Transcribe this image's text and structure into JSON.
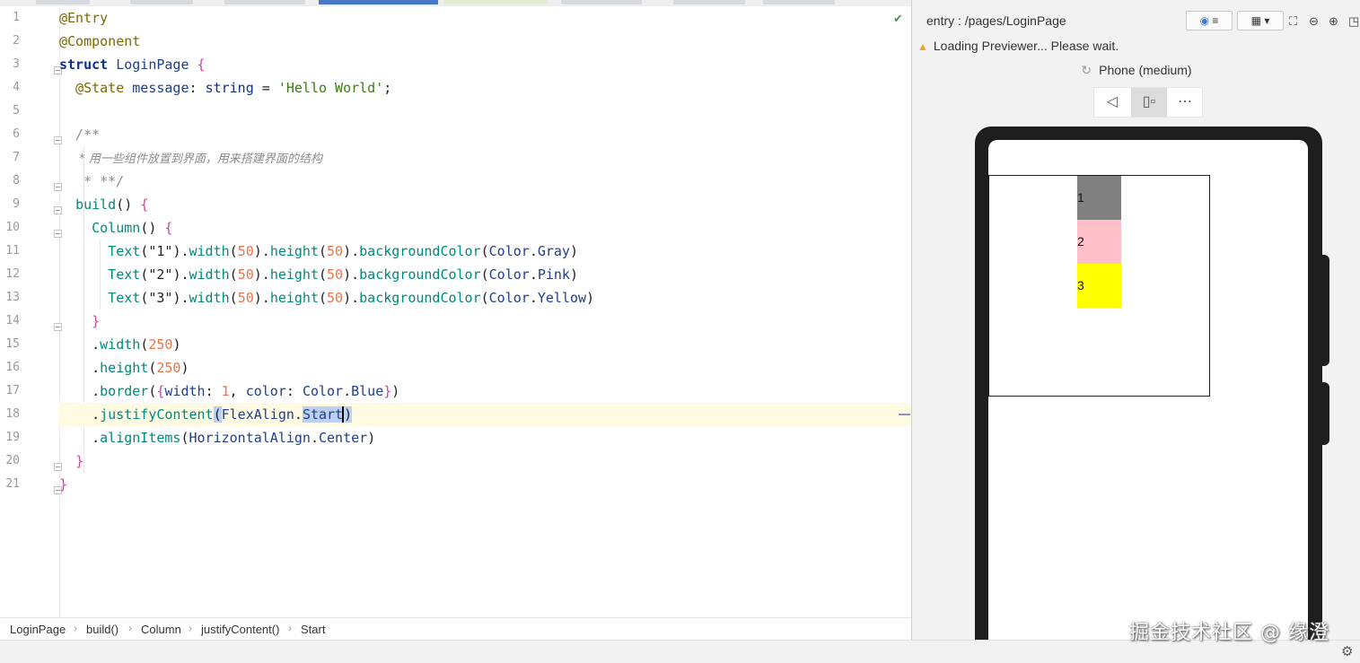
{
  "editor": {
    "line_numbers": [
      "1",
      "2",
      "3",
      "4",
      "5",
      "6",
      "7",
      "8",
      "9",
      "10",
      "11",
      "12",
      "13",
      "14",
      "15",
      "16",
      "17",
      "18",
      "19",
      "20",
      "21"
    ],
    "code": {
      "l1": "@Entry",
      "l2": "@Component",
      "l3_kw": "struct",
      "l3_name": "LoginPage",
      "l4_deco": "@State",
      "l4_var": "message",
      "l4_type": "string",
      "l4_str": "'Hello World'",
      "l6": "/**",
      "l7": " * 用一些组件放置到界面，用来搭建界面的结构",
      "l8": " * **/",
      "l9": "build",
      "l10": "Column",
      "row1_arg": "\"1\"",
      "row2_arg": "\"2\"",
      "row3_arg": "\"3\"",
      "num50": "50",
      "color_gray": "Gray",
      "color_pink": "Pink",
      "color_yellow": "Yellow",
      "num250": "250",
      "num1": "1",
      "align_enum": "FlexAlign",
      "align_value": "Start",
      "halign_enum": "HorizontalAlign",
      "halign_value": "Center"
    },
    "valid_icon": "check-icon"
  },
  "breadcrumbs": [
    "LoginPage",
    "build()",
    "Column",
    "justifyContent()",
    "Start"
  ],
  "previewer": {
    "entry_path": "entry : /pages/LoginPage",
    "warning": "Loading Previewer... Please wait.",
    "device": "Phone (medium)",
    "toolbar_icons": [
      "inspector-icon",
      "layers-icon",
      "grid-icon",
      "dropdown-icon",
      "fit-icon",
      "zoom-out-icon",
      "zoom-in-icon",
      "maximize-icon"
    ],
    "device_tools": [
      "back-icon",
      "rotate-device-icon",
      "more-icon"
    ],
    "boxes": [
      {
        "label": "1",
        "color": "#808080"
      },
      {
        "label": "2",
        "color": "#ffc0cb"
      },
      {
        "label": "3",
        "color": "#ffff00"
      }
    ],
    "column_border_color": "#0000ff"
  },
  "watermark": "掘金技术社区 @ 缘澄"
}
